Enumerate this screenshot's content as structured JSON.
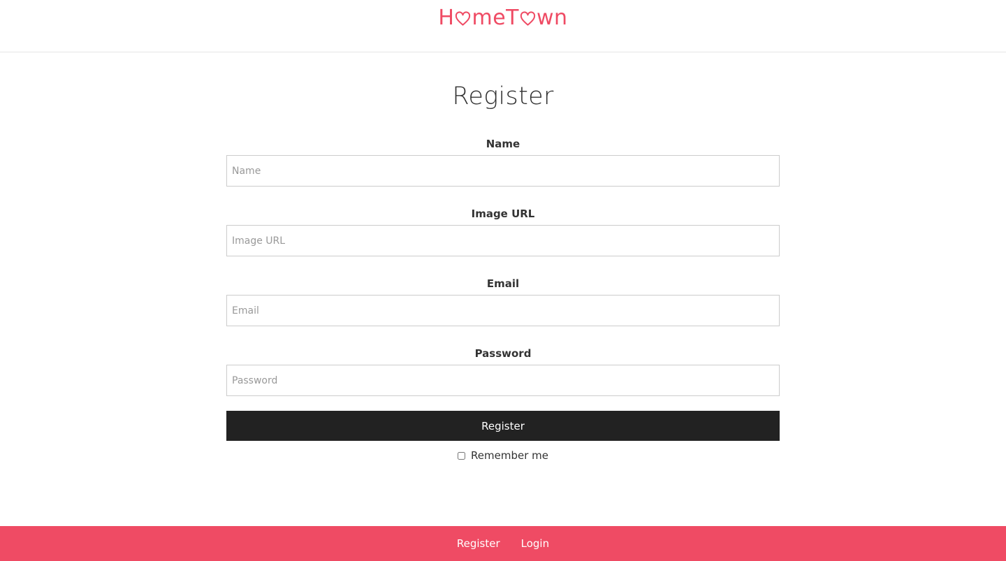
{
  "brand": {
    "name": "HomeTown",
    "color": "#ef4b64",
    "logo_parts": {
      "a": "H",
      "b": "me",
      "c": "T",
      "d": "wn"
    }
  },
  "page": {
    "title": "Register"
  },
  "form": {
    "fields": [
      {
        "label": "Name",
        "placeholder": "Name",
        "value": ""
      },
      {
        "label": "Image URL",
        "placeholder": "Image URL",
        "value": ""
      },
      {
        "label": "Email",
        "placeholder": "Email",
        "value": ""
      },
      {
        "label": "Password",
        "placeholder": "Password",
        "value": ""
      }
    ],
    "submit_label": "Register",
    "remember_label": "Remember me",
    "remember_checked": false
  },
  "footer": {
    "links": [
      {
        "label": "Register"
      },
      {
        "label": "Login"
      }
    ],
    "background": "#ef4b64"
  },
  "colors": {
    "button_bg": "#222222",
    "text": "#333333"
  }
}
